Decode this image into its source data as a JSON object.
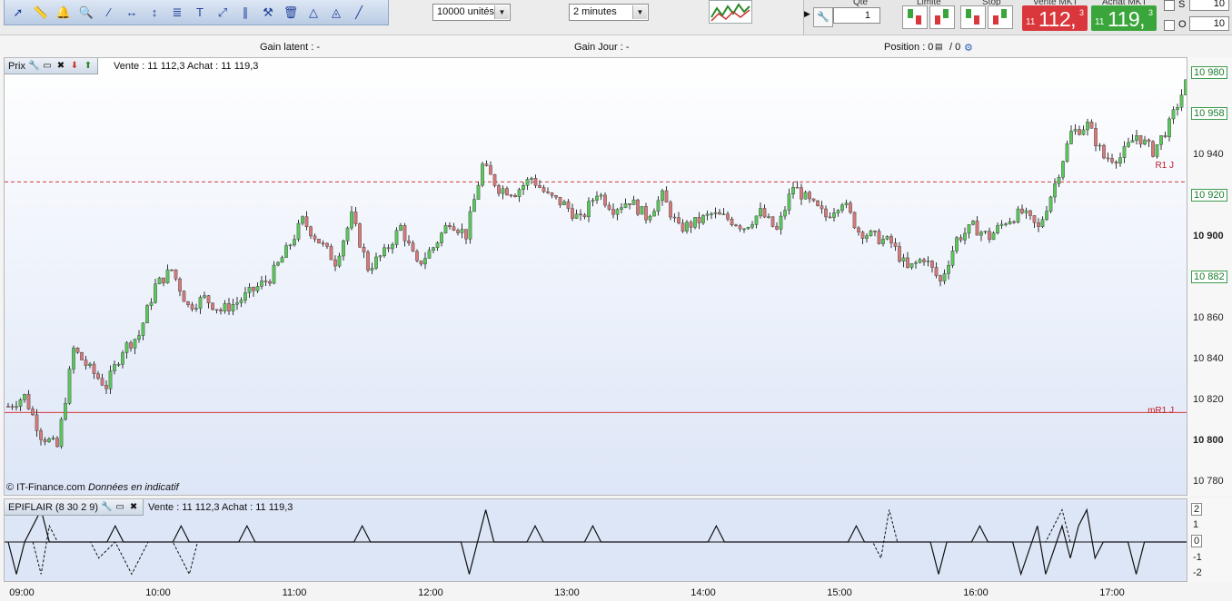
{
  "toolbar": {
    "tool_icons": [
      "cursor-icon",
      "ruler-icon",
      "alert-bell-icon",
      "zoom-icon",
      "line-icon",
      "horizontal-line-icon",
      "vertical-line-icon",
      "fibonacci-icon",
      "text-icon",
      "channel-icon",
      "parallel-icon",
      "tools-icon",
      "trash-icon",
      "triangle-icon",
      "pattern-icon",
      "line2-icon"
    ],
    "quantity_select": "10000 unités",
    "interval_select": "2 minutes"
  },
  "order_panel": {
    "qte_label": "Qté",
    "qte_value": "1",
    "limite_label": "Limite",
    "stop_label": "Stop",
    "vente_label": "Vente MKT",
    "achat_label": "Achat MKT",
    "vente_small": "11",
    "vente_big": "112,",
    "vente_sup": "3",
    "achat_small": "11",
    "achat_big": "119,",
    "achat_sup": "3",
    "s_label": "S",
    "s_value": "10",
    "o_label": "O",
    "o_value": "10",
    "vente_color": "#d9373c",
    "achat_color": "#3aa53a"
  },
  "info_bar": {
    "gain_latent": "Gain latent : -",
    "gain_jour": "Gain Jour : -",
    "position": "Position : 0",
    "position_slash": "/ 0"
  },
  "price_panel": {
    "title": "Prix",
    "quote": "Vente : 11 112,3 Achat : 11 119,3",
    "credit": "© IT-Finance.com",
    "credit_note": "Données en indicatif",
    "r1_label": "R1 J",
    "mr1_label": "mR1 J"
  },
  "indicator_panel": {
    "title": "EPIFLAIR (8 30 2 9)",
    "quote": "Vente : 11 112,3 Achat : 11 119,3"
  },
  "chart_data": [
    {
      "type": "candlestick",
      "title": "Prix",
      "ylim": [
        10775,
        10985
      ],
      "y_ticks": [
        10780,
        10800,
        10820,
        10840,
        10860,
        10880,
        10900,
        10920,
        10940,
        10960,
        10980
      ],
      "y_tick_labels": [
        "10 780",
        "10 800",
        "10 820",
        "10 840",
        "10 860",
        "10 882",
        "10 900",
        "10 920",
        "10 940",
        "10 958",
        "10 980"
      ],
      "highlighted_ticks": [
        "10 980",
        "10 958",
        "10 920",
        "10 882"
      ],
      "bold_ticks": [
        "10 800",
        "10 900"
      ],
      "x_ticks": [
        "09:00",
        "10:00",
        "11:00",
        "12:00",
        "13:00",
        "14:00",
        "15:00",
        "16:00",
        "17:00"
      ],
      "levels": [
        {
          "name": "R1 J",
          "value": 10927,
          "style": "dashed",
          "color": "#d63a3a"
        },
        {
          "name": "mR1 J",
          "value": 10814,
          "style": "solid",
          "color": "#d63a3a"
        }
      ],
      "up_color": "#5cc85c",
      "down_color": "#d77a7a",
      "close_path": [
        [
          0,
          10817
        ],
        [
          4,
          10822
        ],
        [
          8,
          10803
        ],
        [
          12,
          10797
        ],
        [
          16,
          10845
        ],
        [
          20,
          10835
        ],
        [
          24,
          10827
        ],
        [
          28,
          10845
        ],
        [
          32,
          10852
        ],
        [
          36,
          10876
        ],
        [
          40,
          10884
        ],
        [
          44,
          10866
        ],
        [
          48,
          10870
        ],
        [
          52,
          10864
        ],
        [
          56,
          10868
        ],
        [
          60,
          10874
        ],
        [
          64,
          10880
        ],
        [
          68,
          10893
        ],
        [
          72,
          10908
        ],
        [
          76,
          10898
        ],
        [
          80,
          10888
        ],
        [
          84,
          10910
        ],
        [
          88,
          10885
        ],
        [
          92,
          10892
        ],
        [
          96,
          10905
        ],
        [
          100,
          10886
        ],
        [
          104,
          10895
        ],
        [
          108,
          10908
        ],
        [
          112,
          10901
        ],
        [
          116,
          10935
        ],
        [
          120,
          10924
        ],
        [
          124,
          10922
        ],
        [
          128,
          10929
        ],
        [
          132,
          10920
        ],
        [
          136,
          10916
        ],
        [
          140,
          10908
        ],
        [
          144,
          10922
        ],
        [
          148,
          10914
        ],
        [
          152,
          10918
        ],
        [
          156,
          10910
        ],
        [
          160,
          10920
        ],
        [
          164,
          10904
        ],
        [
          168,
          10907
        ],
        [
          172,
          10911
        ],
        [
          176,
          10909
        ],
        [
          180,
          10905
        ],
        [
          184,
          10912
        ],
        [
          188,
          10903
        ],
        [
          192,
          10925
        ],
        [
          196,
          10917
        ],
        [
          200,
          10910
        ],
        [
          204,
          10918
        ],
        [
          208,
          10903
        ],
        [
          212,
          10900
        ],
        [
          216,
          10897
        ],
        [
          220,
          10884
        ],
        [
          224,
          10890
        ],
        [
          228,
          10878
        ],
        [
          232,
          10899
        ],
        [
          236,
          10905
        ],
        [
          240,
          10900
        ],
        [
          244,
          10908
        ],
        [
          248,
          10912
        ],
        [
          252,
          10904
        ],
        [
          256,
          10926
        ],
        [
          260,
          10951
        ],
        [
          264,
          10955
        ],
        [
          268,
          10939
        ],
        [
          272,
          10939
        ],
        [
          276,
          10950
        ],
        [
          280,
          10942
        ],
        [
          284,
          10955
        ],
        [
          288,
          10975
        ]
      ]
    },
    {
      "type": "line",
      "title": "EPIFLAIR (8 30 2 9)",
      "ylim": [
        -2.2,
        2.2
      ],
      "y_ticks": [
        2,
        1,
        0,
        -1,
        -2
      ],
      "solid_path": [
        [
          0,
          0
        ],
        [
          2,
          -2
        ],
        [
          4,
          0
        ],
        [
          8,
          2
        ],
        [
          10,
          0
        ],
        [
          24,
          0
        ],
        [
          26,
          1
        ],
        [
          28,
          0
        ],
        [
          40,
          0
        ],
        [
          42,
          1
        ],
        [
          44,
          0
        ],
        [
          56,
          0
        ],
        [
          58,
          1
        ],
        [
          60,
          0
        ],
        [
          84,
          0
        ],
        [
          86,
          1
        ],
        [
          88,
          0
        ],
        [
          110,
          0
        ],
        [
          112,
          -2
        ],
        [
          116,
          2
        ],
        [
          118,
          0
        ],
        [
          126,
          0
        ],
        [
          128,
          1
        ],
        [
          130,
          0
        ],
        [
          140,
          0
        ],
        [
          142,
          1
        ],
        [
          144,
          0
        ],
        [
          170,
          0
        ],
        [
          172,
          1
        ],
        [
          174,
          0
        ],
        [
          204,
          0
        ],
        [
          206,
          1
        ],
        [
          208,
          0
        ],
        [
          224,
          0
        ],
        [
          226,
          -2
        ],
        [
          228,
          0
        ],
        [
          234,
          0
        ],
        [
          236,
          1
        ],
        [
          238,
          0
        ],
        [
          244,
          0
        ],
        [
          246,
          -2
        ],
        [
          250,
          1
        ],
        [
          252,
          -2
        ],
        [
          256,
          1
        ],
        [
          258,
          -1
        ],
        [
          260,
          1
        ],
        [
          262,
          2
        ],
        [
          264,
          -1
        ],
        [
          266,
          0
        ],
        [
          272,
          0
        ],
        [
          274,
          -2
        ],
        [
          276,
          0
        ],
        [
          292,
          0
        ],
        [
          294,
          -2
        ],
        [
          296,
          0
        ],
        [
          318,
          0
        ],
        [
          320,
          -1
        ],
        [
          322,
          0
        ],
        [
          328,
          0
        ],
        [
          330,
          -1
        ],
        [
          332,
          0
        ],
        [
          342,
          0
        ],
        [
          344,
          -1
        ],
        [
          346,
          0
        ],
        [
          348,
          -1
        ],
        [
          350,
          0
        ],
        [
          356,
          0
        ],
        [
          358,
          -1
        ],
        [
          360,
          0
        ],
        [
          406,
          0
        ],
        [
          408,
          -1
        ],
        [
          410,
          0
        ],
        [
          416,
          0
        ],
        [
          418,
          1
        ],
        [
          420,
          0
        ]
      ],
      "dashed_path": [
        [
          6,
          0
        ],
        [
          8,
          -2
        ],
        [
          10,
          1
        ],
        [
          12,
          0
        ],
        [
          20,
          0
        ],
        [
          22,
          -1
        ],
        [
          26,
          0
        ],
        [
          30,
          -2
        ],
        [
          32,
          -1
        ],
        [
          34,
          0
        ],
        [
          40,
          0
        ],
        [
          42,
          -1
        ],
        [
          44,
          -2
        ],
        [
          46,
          0
        ],
        [
          210,
          0
        ],
        [
          212,
          -1
        ],
        [
          214,
          2
        ],
        [
          216,
          0
        ],
        [
          252,
          0
        ],
        [
          254,
          1
        ],
        [
          256,
          2
        ],
        [
          258,
          0
        ],
        [
          294,
          0
        ],
        [
          296,
          -2
        ],
        [
          298,
          0
        ],
        [
          302,
          0
        ],
        [
          304,
          -1
        ],
        [
          306,
          0
        ],
        [
          404,
          0
        ],
        [
          406,
          -1
        ],
        [
          408,
          0
        ],
        [
          420,
          0
        ],
        [
          422,
          1
        ],
        [
          424,
          0
        ]
      ]
    }
  ]
}
